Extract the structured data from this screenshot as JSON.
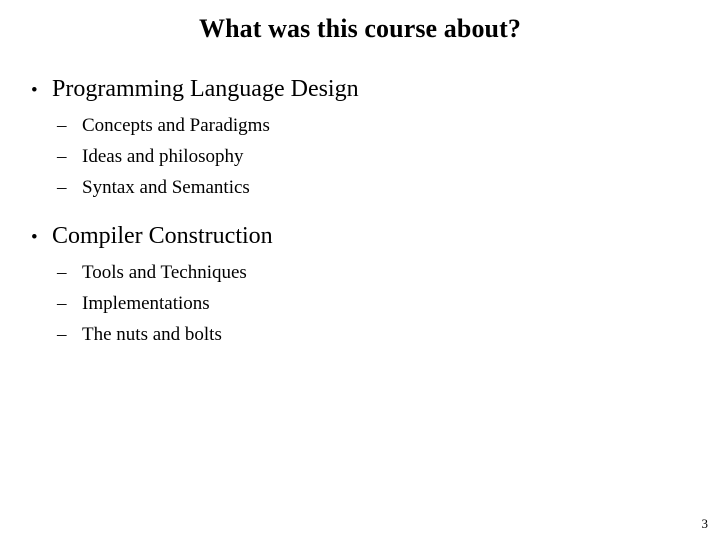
{
  "slide": {
    "title": "What was this course about?",
    "page_number": "3",
    "background_color": "#ffffff",
    "text_color": "#000000",
    "bullet_marker": "•",
    "sub_bullet_marker": "–",
    "groups": [
      {
        "heading": "Programming Language Design",
        "items": [
          "Concepts and Paradigms",
          "Ideas and philosophy",
          "Syntax and Semantics"
        ]
      },
      {
        "heading": "Compiler Construction",
        "items": [
          "Tools and Techniques",
          "Implementations",
          "The nuts and bolts"
        ]
      }
    ]
  }
}
